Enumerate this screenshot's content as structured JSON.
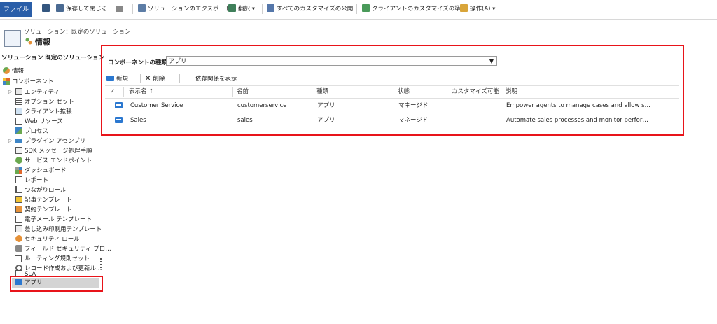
{
  "toolbar": {
    "file": "ファイル",
    "save_close": "保存して閉じる",
    "export": "ソリューションのエクスポート",
    "translate": "翻訳",
    "publish_all": "すべてのカスタマイズの公開",
    "prepare_client": "クライアントのカスタマイズの準備",
    "actions": "操作(A)"
  },
  "header": {
    "breadcrumb": "ソリューション：既定のソリューション",
    "title": "情報"
  },
  "sidebar": {
    "title": "ソリューション 既定のソリューション",
    "items": [
      {
        "label": "情報"
      },
      {
        "label": "コンポーネント"
      },
      {
        "label": "エンティティ"
      },
      {
        "label": "オプション セット"
      },
      {
        "label": "クライアント拡張"
      },
      {
        "label": "Web リソース"
      },
      {
        "label": "プロセス"
      },
      {
        "label": "プラグイン アセンブリ"
      },
      {
        "label": "SDK メッセージ処理手順"
      },
      {
        "label": "サービス エンドポイント"
      },
      {
        "label": "ダッシュボード"
      },
      {
        "label": "レポート"
      },
      {
        "label": "つながりロール"
      },
      {
        "label": "記事テンプレート"
      },
      {
        "label": "契約テンプレート"
      },
      {
        "label": "電子メール テンプレート"
      },
      {
        "label": "差し込み印刷用テンプレート"
      },
      {
        "label": "セキュリティ ロール"
      },
      {
        "label": "フィールド セキュリティ プロ…"
      },
      {
        "label": "ルーティング規則セット"
      },
      {
        "label": "レコード作成および更新ル…"
      },
      {
        "label": "SLA"
      },
      {
        "label": "アプリ"
      }
    ]
  },
  "main": {
    "component_type_label": "コンポーネントの種類",
    "component_type_value": "アプリ",
    "new": "新規",
    "delete": "削除",
    "show_dependencies": "依存関係を表示",
    "columns": [
      "表示名 ↑",
      "名前",
      "種類",
      "状態",
      "カスタマイズ可能",
      "説明"
    ],
    "rows": [
      {
        "display_name": "Customer Service",
        "name": "customerservice",
        "type": "アプリ",
        "state": "マネージド",
        "customizable": "",
        "description": "Empower agents to manage cases and allow s…"
      },
      {
        "display_name": "Sales",
        "name": "sales",
        "type": "アプリ",
        "state": "マネージド",
        "customizable": "",
        "description": "Automate sales processes and monitor perfor…"
      }
    ]
  },
  "colors": {
    "accent": "#2a5ea8",
    "highlight": "#e8141a",
    "app_icon": "#2b78d0"
  }
}
